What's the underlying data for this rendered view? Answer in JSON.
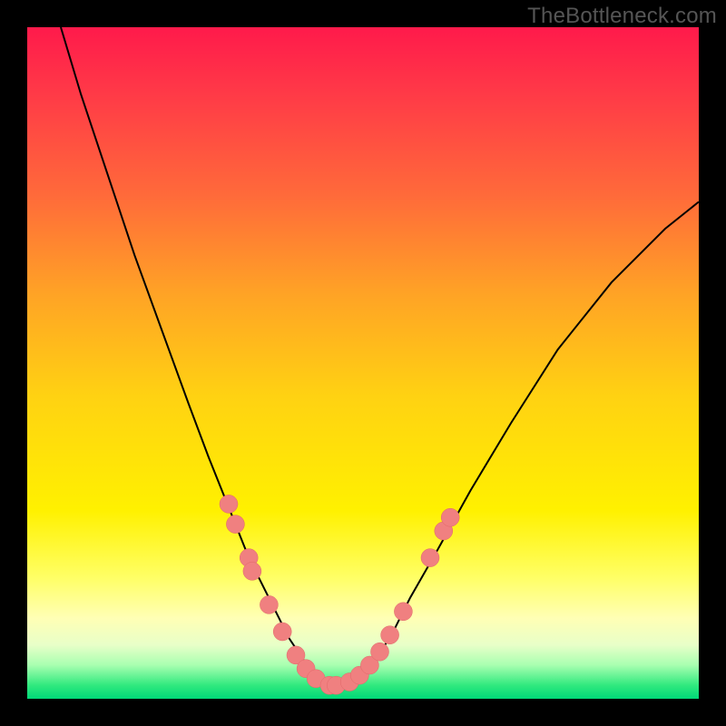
{
  "watermark": "TheBottleneck.com",
  "colors": {
    "background": "#000000",
    "gradient_top": "#ff1a4b",
    "gradient_bottom": "#00d878",
    "curve": "#000000",
    "dots": "#f08080"
  },
  "chart_data": {
    "type": "line",
    "title": "",
    "xlabel": "",
    "ylabel": "",
    "xlim": [
      0,
      100
    ],
    "ylim": [
      0,
      100
    ],
    "grid": false,
    "legend": false,
    "series": [
      {
        "name": "bottleneck_curve",
        "x": [
          5,
          8,
          12,
          16,
          20,
          24,
          27,
          29,
          31,
          33,
          35,
          37,
          39,
          41,
          43,
          45,
          47,
          49,
          51,
          54,
          57,
          61,
          66,
          72,
          79,
          87,
          95,
          100
        ],
        "y": [
          100,
          90,
          78,
          66,
          55,
          44,
          36,
          31,
          26,
          21,
          17,
          13,
          9,
          6,
          3,
          2,
          2,
          3,
          5,
          9,
          15,
          22,
          31,
          41,
          52,
          62,
          70,
          74
        ]
      }
    ],
    "markers": [
      {
        "x": 30,
        "y": 29
      },
      {
        "x": 31,
        "y": 26
      },
      {
        "x": 33,
        "y": 21
      },
      {
        "x": 33.5,
        "y": 19
      },
      {
        "x": 36,
        "y": 14
      },
      {
        "x": 38,
        "y": 10
      },
      {
        "x": 40,
        "y": 6.5
      },
      {
        "x": 41.5,
        "y": 4.5
      },
      {
        "x": 43,
        "y": 3
      },
      {
        "x": 45,
        "y": 2
      },
      {
        "x": 46,
        "y": 2
      },
      {
        "x": 48,
        "y": 2.5
      },
      {
        "x": 49.5,
        "y": 3.5
      },
      {
        "x": 51,
        "y": 5
      },
      {
        "x": 52.5,
        "y": 7
      },
      {
        "x": 54,
        "y": 9.5
      },
      {
        "x": 56,
        "y": 13
      },
      {
        "x": 60,
        "y": 21
      },
      {
        "x": 62,
        "y": 25
      },
      {
        "x": 63,
        "y": 27
      }
    ]
  }
}
